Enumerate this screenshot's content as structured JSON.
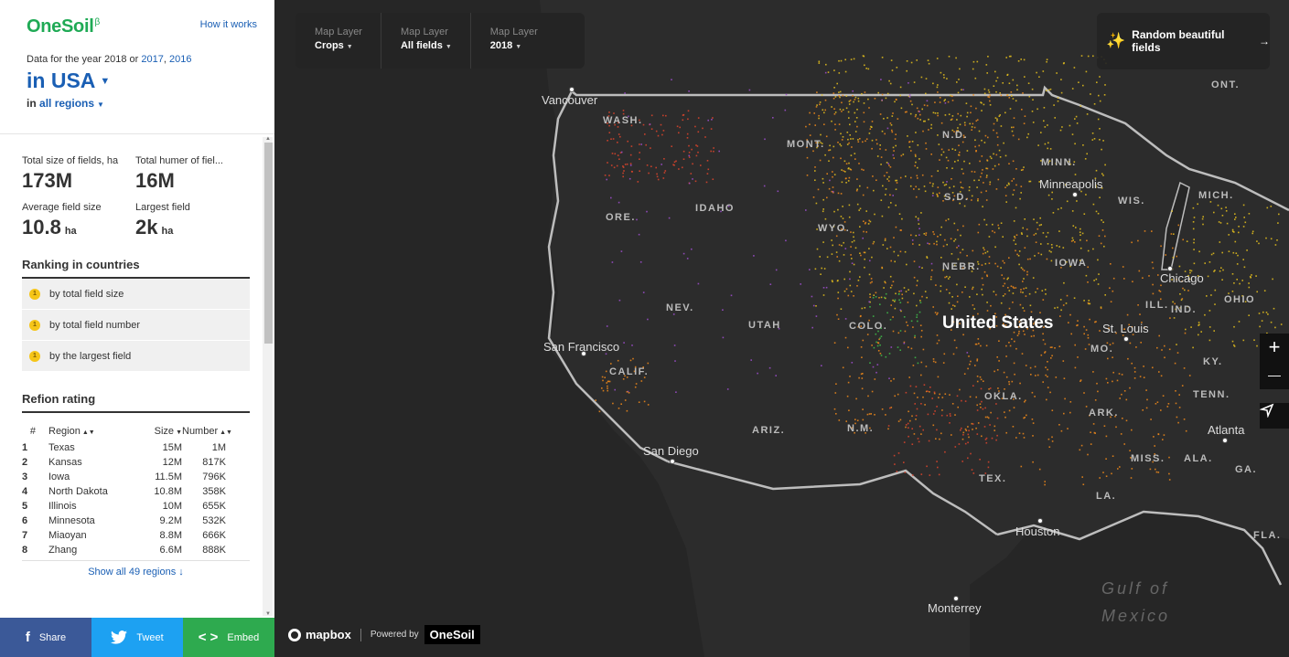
{
  "sidebar": {
    "logo": "OneSoil",
    "logo_mark": "β",
    "how_it_works": "How it works",
    "data_year_prefix": "Data for the year 2018 or",
    "year_links": [
      "2017",
      "2016"
    ],
    "country": "in USA",
    "region_prefix": "in",
    "region": "all regions",
    "stats": [
      {
        "label": "Total size of fields, ha",
        "value": "173M",
        "unit": ""
      },
      {
        "label": "Total humer of fiel...",
        "value": "16M",
        "unit": ""
      },
      {
        "label": "Average field size",
        "value": "10.8",
        "unit": "ha"
      },
      {
        "label": "Largest field",
        "value": "2k",
        "unit": "ha"
      }
    ],
    "ranking_title": "Ranking in countries",
    "ranking": [
      {
        "badge": "1",
        "label": "by total field size"
      },
      {
        "badge": "1",
        "label": "by total field number"
      },
      {
        "badge": "1",
        "label": "by the largest field"
      }
    ],
    "region_title": "Refion rating",
    "table_headers": {
      "idx": "#",
      "region": "Region",
      "size": "Size",
      "number": "Number"
    },
    "table_rows": [
      {
        "idx": "1",
        "region": "Texas",
        "size": "15M",
        "number": "1M"
      },
      {
        "idx": "2",
        "region": "Kansas",
        "size": "12M",
        "number": "817K"
      },
      {
        "idx": "3",
        "region": "Iowa",
        "size": "11.5M",
        "number": "796K"
      },
      {
        "idx": "4",
        "region": "North Dakota",
        "size": "10.8M",
        "number": "358K"
      },
      {
        "idx": "5",
        "region": "Illinois",
        "size": "10M",
        "number": "655K"
      },
      {
        "idx": "6",
        "region": "Minnesota",
        "size": "9.2M",
        "number": "532K"
      },
      {
        "idx": "7",
        "region": "Miaoyan",
        "size": "8.8M",
        "number": "666K"
      },
      {
        "idx": "8",
        "region": "Zhang",
        "size": "6.6M",
        "number": "888K"
      }
    ],
    "show_all": "Show all 49 regions ↓",
    "share": {
      "share": "Share",
      "tweet": "Tweet",
      "embed": "Embed"
    }
  },
  "map": {
    "layers": [
      {
        "label": "Map Layer",
        "value": "Crops"
      },
      {
        "label": "Map Layer",
        "value": "All fields"
      },
      {
        "label": "Map Layer",
        "value": "2018"
      }
    ],
    "random_button": "Random beautiful fields",
    "random_arrow": "→",
    "zoom_in": "+",
    "zoom_out": "—",
    "mapbox": "mapbox",
    "powered_by": "Powered by",
    "powered_logo": "OneSoil",
    "country_label": "United States",
    "state_labels": [
      "WASH.",
      "MONT.",
      "N.D.",
      "MINN.",
      "S.D.",
      "ORE.",
      "IDAHO",
      "WYO.",
      "WIS.",
      "MICH.",
      "NEBR.",
      "IOWA",
      "NEV.",
      "UTAH",
      "COLO.",
      "ILL.",
      "IND.",
      "OHIO",
      "CALIF.",
      "MO.",
      "KY.",
      "OKLA.",
      "TENN.",
      "ARIZ.",
      "N.M.",
      "ARK.",
      "MISS.",
      "ALA.",
      "GA.",
      "TEX.",
      "LA.",
      "FLA.",
      "ONT."
    ],
    "cities": [
      "Vancouver",
      "Minneapolis",
      "Chicago",
      "San Francisco",
      "St. Louis",
      "San Diego",
      "Atlanta",
      "Houston",
      "Monterrey"
    ],
    "water_labels": [
      "Gulf of",
      "Mexico"
    ],
    "colors": {
      "land": "#333333",
      "water": "#2a2a2a",
      "border": "#bdbdbd",
      "fields_yellow": "#e8c21c",
      "fields_orange": "#f28a1a",
      "fields_red": "#e0452b",
      "fields_purple": "#a04fd0",
      "fields_green": "#3fbf4a"
    }
  }
}
